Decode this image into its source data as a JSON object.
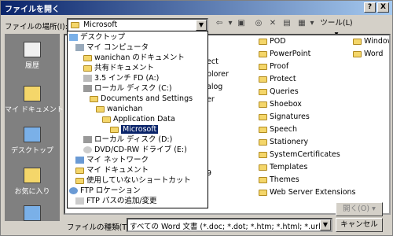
{
  "window": {
    "title": "ファイルを開く",
    "help_btn": "?",
    "close_btn": "X"
  },
  "look_in": {
    "label": "ファイルの場所(I):",
    "value": "Microsoft"
  },
  "toolbar": {
    "back": "⇦",
    "up": "▣",
    "search": "◎",
    "delete": "✕",
    "new_folder": "▤",
    "views": "▦",
    "tools": "ツール(L)"
  },
  "places": [
    {
      "label": "履歴"
    },
    {
      "label": "マイ ドキュメント"
    },
    {
      "label": "デスクトップ"
    },
    {
      "label": "お気に入り"
    }
  ],
  "dropdown": {
    "items": [
      {
        "label": "デスクトップ"
      },
      {
        "label": "マイ コンピュータ"
      },
      {
        "label": "wanichan のドキュメント"
      },
      {
        "label": "共有ドキュメント"
      },
      {
        "label": "3.5 インチ FD (A:)"
      },
      {
        "label": "ローカル ディスク (C:)"
      },
      {
        "label": "Documents and Settings"
      },
      {
        "label": "wanichan"
      },
      {
        "label": "Application Data"
      },
      {
        "label": "Microsoft"
      },
      {
        "label": "ローカル ディスク (D:)"
      },
      {
        "label": "DVD/CD-RW ドライブ (E:)"
      },
      {
        "label": "マイ ネットワーク"
      },
      {
        "label": "マイ ドキュメント"
      },
      {
        "label": "使用していないショートカット"
      },
      {
        "label": "FTP ロケーション"
      },
      {
        "label": "FTP パスの追加/変更"
      }
    ]
  },
  "files": {
    "col1_partial": [
      "ect",
      "plorer",
      "alog",
      "er",
      "9"
    ],
    "col2": [
      "POD",
      "PowerPoint",
      "Proof",
      "Protect",
      "Queries",
      "Shoebox",
      "Signatures",
      "Speech",
      "Stationery",
      "SystemCertificates",
      "Templates",
      "Themes",
      "Web Server Extensions"
    ],
    "col3": [
      "Window",
      "Word"
    ]
  },
  "filetype": {
    "label": "ファイルの種類(T):",
    "value": "すべての Word 文書 (*.doc; *.dot; *.htm; *.html; *.url; *.rtf"
  },
  "buttons": {
    "open": "開く(O)",
    "cancel": "キャンセル"
  }
}
